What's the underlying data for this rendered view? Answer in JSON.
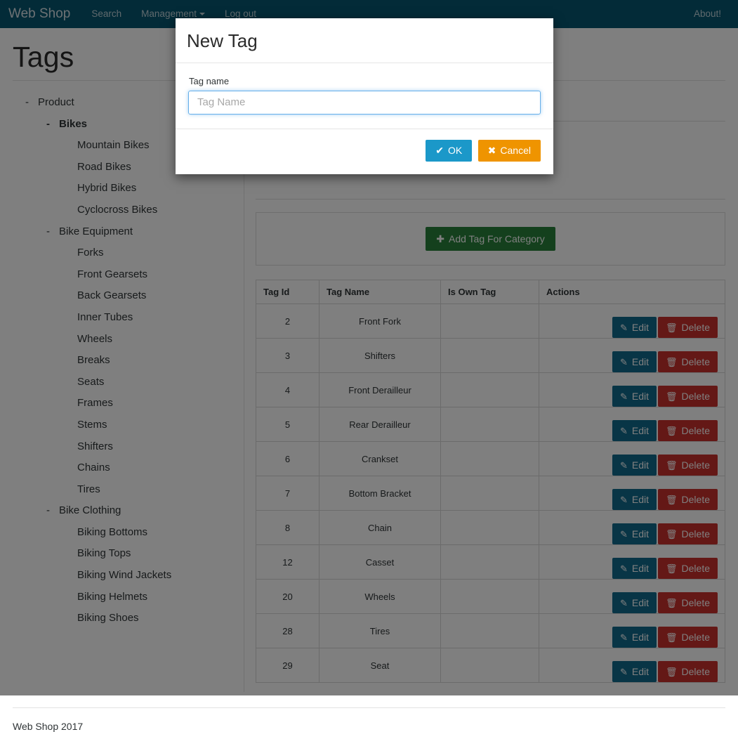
{
  "navbar": {
    "brand": "Web Shop",
    "links": [
      {
        "label": "Search",
        "icon": null
      },
      {
        "label": "Management",
        "icon": "caret-down-icon"
      },
      {
        "label": "Log out",
        "icon": null
      }
    ],
    "right_link": "About!",
    "background_color": "#075670"
  },
  "page": {
    "title": "Tags",
    "footer": "Web Shop 2017"
  },
  "tree": {
    "nodes": [
      {
        "label": "Product",
        "level": 1,
        "expander": "-",
        "bold": false
      },
      {
        "label": "Bikes",
        "level": 2,
        "expander": "-",
        "bold": true
      },
      {
        "label": "Mountain Bikes",
        "level": 3,
        "expander": "",
        "bold": false
      },
      {
        "label": "Road Bikes",
        "level": 3,
        "expander": "",
        "bold": false
      },
      {
        "label": "Hybrid Bikes",
        "level": 3,
        "expander": "",
        "bold": false
      },
      {
        "label": "Cyclocross Bikes",
        "level": 3,
        "expander": "",
        "bold": false
      },
      {
        "label": "Bike Equipment",
        "level": 2,
        "expander": "-",
        "bold": false
      },
      {
        "label": "Forks",
        "level": 3,
        "expander": "",
        "bold": false
      },
      {
        "label": "Front Gearsets",
        "level": 3,
        "expander": "",
        "bold": false
      },
      {
        "label": "Back Gearsets",
        "level": 3,
        "expander": "",
        "bold": false
      },
      {
        "label": "Inner Tubes",
        "level": 3,
        "expander": "",
        "bold": false
      },
      {
        "label": "Wheels",
        "level": 3,
        "expander": "",
        "bold": false
      },
      {
        "label": "Breaks",
        "level": 3,
        "expander": "",
        "bold": false
      },
      {
        "label": "Seats",
        "level": 3,
        "expander": "",
        "bold": false
      },
      {
        "label": "Frames",
        "level": 3,
        "expander": "",
        "bold": false
      },
      {
        "label": "Stems",
        "level": 3,
        "expander": "",
        "bold": false
      },
      {
        "label": "Shifters",
        "level": 3,
        "expander": "",
        "bold": false
      },
      {
        "label": "Chains",
        "level": 3,
        "expander": "",
        "bold": false
      },
      {
        "label": "Tires",
        "level": 3,
        "expander": "",
        "bold": false
      },
      {
        "label": "Bike Clothing",
        "level": 2,
        "expander": "-",
        "bold": false
      },
      {
        "label": "Biking Bottoms",
        "level": 3,
        "expander": "",
        "bold": false
      },
      {
        "label": "Biking Tops",
        "level": 3,
        "expander": "",
        "bold": false
      },
      {
        "label": "Biking Wind Jackets",
        "level": 3,
        "expander": "",
        "bold": false
      },
      {
        "label": "Biking Helmets",
        "level": 3,
        "expander": "",
        "bold": false
      },
      {
        "label": "Biking Shoes",
        "level": 3,
        "expander": "",
        "bold": false
      }
    ]
  },
  "content": {
    "add_button": {
      "label": "Add Tag For Category",
      "icon": "plus-icon",
      "color": "#28803b"
    },
    "table": {
      "columns": [
        "Tag Id",
        "Tag Name",
        "Is Own Tag",
        "Actions"
      ],
      "row_actions": {
        "edit": {
          "label": "Edit",
          "icon": "pencil-square-icon",
          "color": "#106b8c"
        },
        "delete": {
          "label": "Delete",
          "icon": "trash-icon",
          "color": "#c9302c"
        }
      },
      "rows": [
        {
          "id": "2",
          "name": "Front Fork",
          "is_own": ""
        },
        {
          "id": "3",
          "name": "Shifters",
          "is_own": ""
        },
        {
          "id": "4",
          "name": "Front Derailleur",
          "is_own": ""
        },
        {
          "id": "5",
          "name": "Rear Derailleur",
          "is_own": ""
        },
        {
          "id": "6",
          "name": "Crankset",
          "is_own": ""
        },
        {
          "id": "7",
          "name": "Bottom Bracket",
          "is_own": ""
        },
        {
          "id": "8",
          "name": "Chain",
          "is_own": ""
        },
        {
          "id": "12",
          "name": "Casset",
          "is_own": ""
        },
        {
          "id": "20",
          "name": "Wheels",
          "is_own": ""
        },
        {
          "id": "28",
          "name": "Tires",
          "is_own": ""
        },
        {
          "id": "29",
          "name": "Seat",
          "is_own": ""
        }
      ]
    }
  },
  "modal": {
    "title": "New Tag",
    "field_label": "Tag name",
    "field_value": "",
    "field_placeholder": "Tag Name",
    "ok_label": "OK",
    "ok_icon": "check-icon",
    "ok_color": "#1b98c9",
    "cancel_label": "Cancel",
    "cancel_icon": "times-icon",
    "cancel_color": "#ef9400"
  }
}
